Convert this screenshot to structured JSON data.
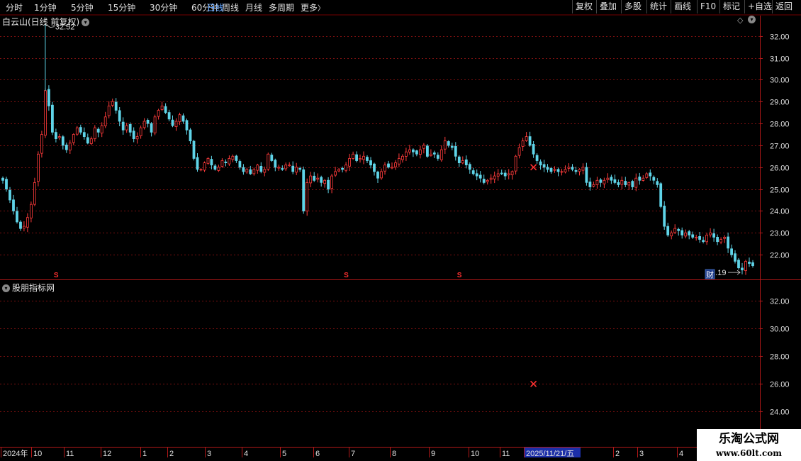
{
  "toolbar": {
    "periods": [
      "分时",
      "1分钟",
      "5分钟",
      "15分钟",
      "30分钟",
      "60分钟",
      "日线",
      "周线",
      "月线",
      "多周期",
      "更多"
    ],
    "active": "日线",
    "more_arrow": "〉",
    "buttons": [
      "复权",
      "叠加",
      "多股",
      "统计",
      "画线",
      "F10",
      "标记",
      "+自选",
      "返回"
    ]
  },
  "main_title": "白云山(日线 前复权)",
  "indicator_title": "股朋指标网",
  "diamond_icon": "◇",
  "watermark": {
    "title": "乐淘公式网",
    "url": "www.60lt.com"
  },
  "colors": {
    "up": "#ff3b3b",
    "down": "#5fd4e8",
    "grid": "#7a1010",
    "border": "#b01818",
    "marker": "#ff3030"
  },
  "chart_data": {
    "type": "candlestick",
    "main_axis": {
      "ylim": [
        21.0,
        32.8
      ],
      "ticks": [
        "32.00",
        "31.00",
        "30.00",
        "29.00",
        "28.00",
        "27.00",
        "26.00",
        "25.00",
        "24.00",
        "23.00",
        "22.00"
      ]
    },
    "indicator_axis": {
      "ylim": [
        22.7,
        33.2
      ],
      "ticks": [
        "32.00",
        "30.00",
        "28.00",
        "26.00",
        "24.00"
      ]
    },
    "high_label": "32.52",
    "low_label": "21.19",
    "fin_badge": "财",
    "s_marker": "S",
    "time_axis": [
      "2024年",
      "10",
      "11",
      "12",
      "1",
      "2",
      "3",
      "4",
      "5",
      "6",
      "7",
      "8",
      "9",
      "10",
      "11",
      "2025/11/21/五",
      "2",
      "3",
      "4"
    ],
    "events": [
      {
        "type": "x",
        "date_index": 150,
        "value": 26.0,
        "panel": "main"
      },
      {
        "type": "x",
        "date_index": 150,
        "value": 26.0,
        "panel": "indicator"
      },
      {
        "type": "S",
        "date_index": 15
      },
      {
        "type": "S",
        "date_index": 97
      },
      {
        "type": "S",
        "date_index": 129
      }
    ],
    "series_close": [
      25.4,
      25.0,
      24.5,
      24.0,
      23.5,
      23.2,
      23.3,
      23.7,
      24.3,
      25.3,
      26.6,
      27.5,
      29.5,
      28.8,
      27.6,
      27.3,
      27.4,
      27.0,
      26.8,
      27.1,
      27.5,
      27.8,
      27.6,
      27.4,
      27.1,
      27.3,
      27.8,
      27.6,
      27.9,
      28.3,
      28.8,
      29.0,
      28.6,
      28.1,
      27.7,
      27.9,
      27.6,
      27.3,
      27.4,
      27.8,
      28.1,
      28.0,
      27.6,
      28.3,
      28.6,
      28.8,
      28.5,
      28.2,
      27.9,
      28.1,
      28.4,
      28.1,
      27.7,
      27.2,
      26.4,
      25.9,
      25.9,
      26.2,
      26.4,
      26.1,
      25.9,
      26.0,
      26.3,
      26.2,
      26.4,
      26.5,
      26.3,
      26.0,
      25.8,
      25.9,
      25.7,
      25.9,
      26.1,
      25.8,
      25.9,
      26.6,
      26.3,
      26.0,
      26.0,
      25.9,
      26.1,
      26.1,
      25.8,
      26.0,
      25.9,
      24.0,
      25.3,
      25.6,
      25.4,
      25.5,
      25.3,
      25.4,
      25.0,
      25.6,
      25.8,
      25.9,
      25.9,
      26.1,
      26.4,
      26.6,
      26.3,
      26.4,
      26.5,
      26.3,
      26.1,
      25.8,
      25.5,
      25.8,
      26.1,
      26.0,
      26.0,
      26.2,
      26.4,
      26.5,
      26.7,
      26.8,
      26.7,
      26.6,
      26.8,
      27.0,
      26.5,
      26.6,
      26.6,
      26.4,
      26.8,
      27.2,
      27.0,
      26.9,
      26.5,
      26.2,
      26.3,
      26.1,
      25.9,
      25.7,
      25.6,
      25.5,
      25.3,
      25.4,
      25.5,
      25.6,
      25.7,
      25.7,
      25.6,
      25.7,
      25.8,
      26.5,
      26.9,
      27.2,
      27.4,
      27.0,
      26.6,
      26.3,
      26.1,
      26.0,
      25.9,
      25.8,
      25.9,
      25.8,
      25.8,
      25.9,
      26.0,
      25.9,
      25.8,
      25.9,
      26.0,
      25.3,
      25.1,
      25.2,
      25.4,
      25.3,
      25.4,
      25.5,
      25.4,
      25.3,
      25.2,
      25.4,
      25.2,
      25.3,
      25.1,
      25.5,
      25.4,
      25.5,
      25.7,
      25.6,
      25.4,
      25.2,
      24.2,
      23.3,
      22.9,
      23.0,
      23.2,
      23.1,
      22.9,
      23.0,
      22.9,
      22.8,
      22.8,
      22.7,
      22.6,
      22.9,
      23.0,
      22.8,
      22.6,
      22.7,
      22.8,
      22.3,
      22.0,
      21.7,
      21.4,
      21.3,
      21.7,
      21.6,
      21.5
    ]
  }
}
